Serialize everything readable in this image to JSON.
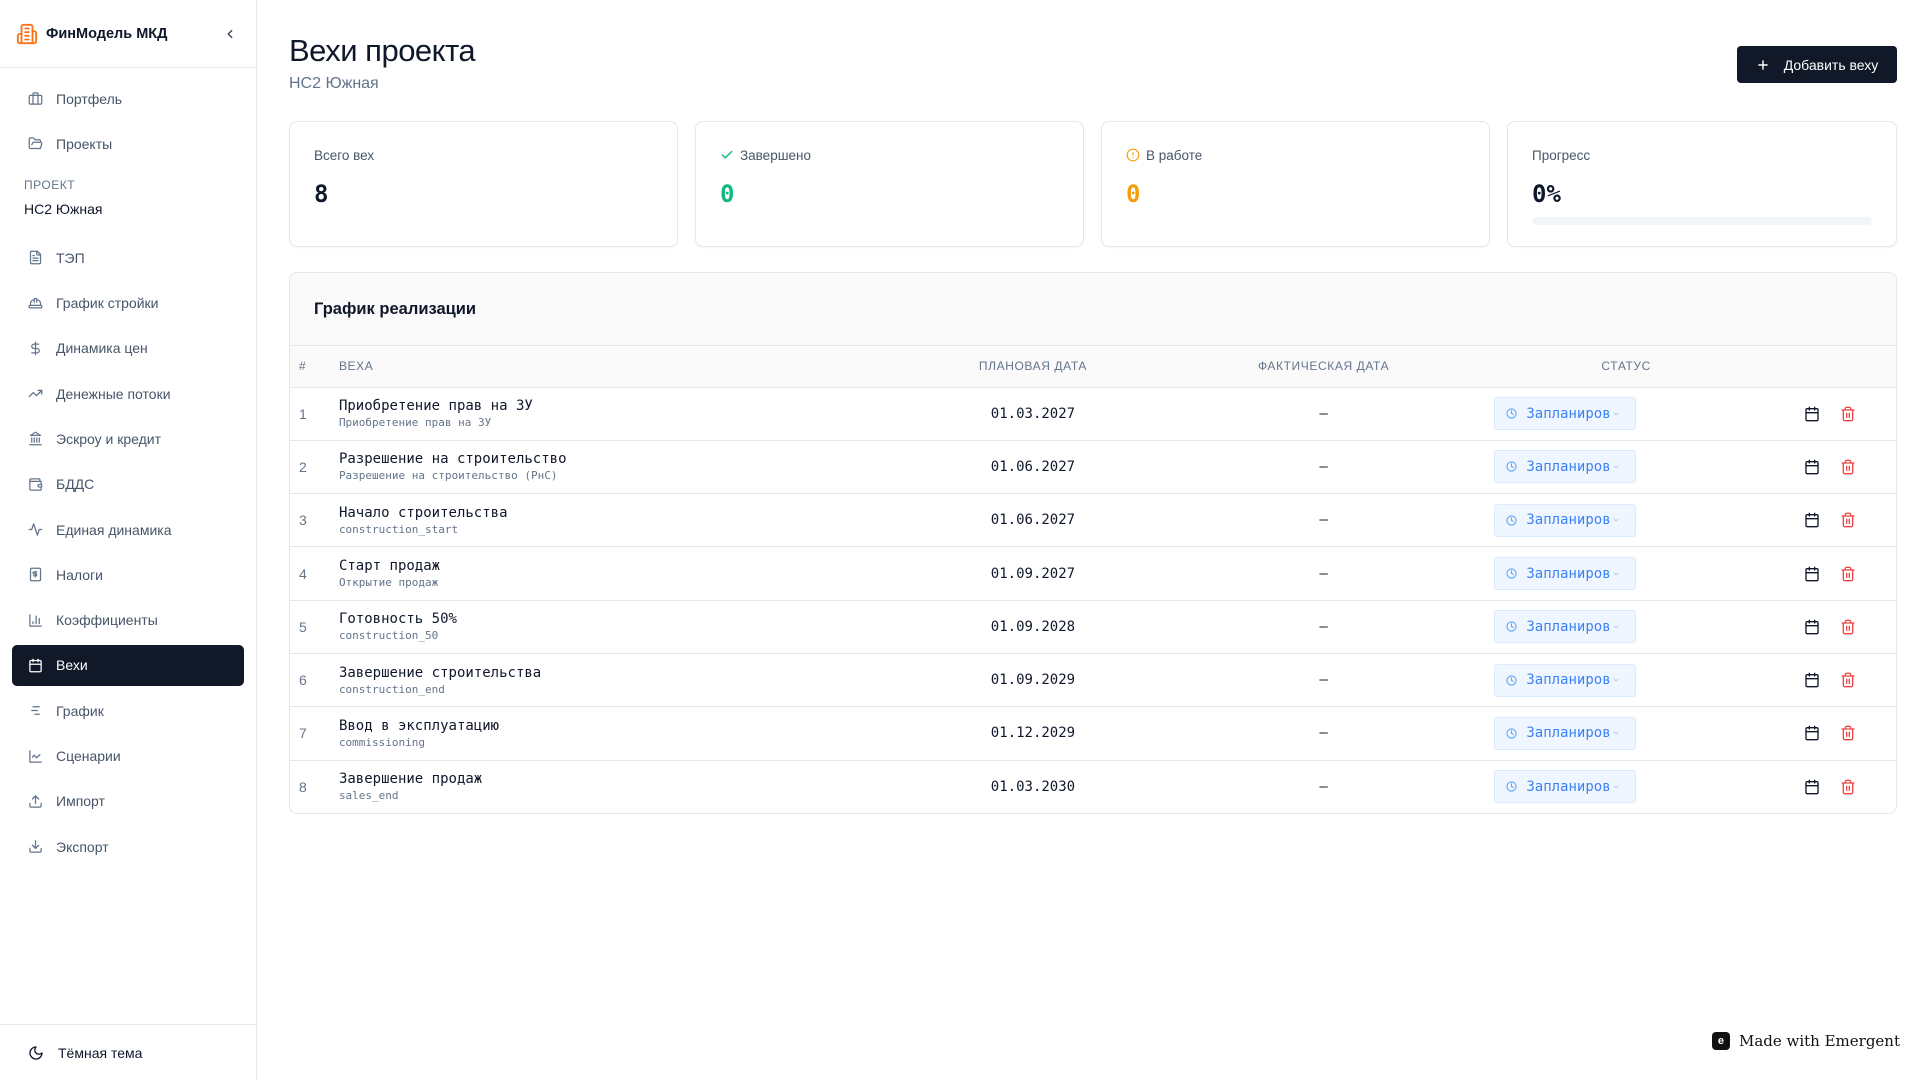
{
  "app": {
    "name": "ФинМодель МКД",
    "accent": "#f97316"
  },
  "sidebar": {
    "top_items": [
      {
        "label": "Портфель",
        "icon": "briefcase-icon"
      },
      {
        "label": "Проекты",
        "icon": "folder-open-icon"
      }
    ],
    "section_label": "ПРОЕКТ",
    "project_name": "НС2 Южная",
    "items": [
      {
        "label": "ТЭП",
        "icon": "file-text-icon"
      },
      {
        "label": "График стройки",
        "icon": "hard-hat-icon"
      },
      {
        "label": "Динамика цен",
        "icon": "dollar-icon"
      },
      {
        "label": "Денежные потоки",
        "icon": "trending-up-icon"
      },
      {
        "label": "Эскроу и кредит",
        "icon": "bank-icon"
      },
      {
        "label": "БДДС",
        "icon": "wallet-icon"
      },
      {
        "label": "Единая динамика",
        "icon": "activity-icon"
      },
      {
        "label": "Налоги",
        "icon": "receipt-icon"
      },
      {
        "label": "Коэффициенты",
        "icon": "bar-chart-icon"
      },
      {
        "label": "Вехи",
        "icon": "calendar-icon",
        "active": true
      },
      {
        "label": "График",
        "icon": "gantt-icon"
      },
      {
        "label": "Сценарии",
        "icon": "line-chart-icon"
      },
      {
        "label": "Импорт",
        "icon": "upload-icon"
      },
      {
        "label": "Экспорт",
        "icon": "download-icon"
      }
    ],
    "footer_label": "Тёмная тема"
  },
  "header": {
    "title": "Вехи проекта",
    "subtitle": "НС2 Южная",
    "add_button": "Добавить веху"
  },
  "stats": {
    "total": {
      "label": "Всего вех",
      "value": "8"
    },
    "done": {
      "label": "Завершено",
      "value": "0",
      "color": "#10b981"
    },
    "in_progress": {
      "label": "В работе",
      "value": "0",
      "color": "#f59e0b"
    },
    "progress": {
      "label": "Прогресс",
      "value": "0%",
      "fraction": 0
    }
  },
  "table": {
    "title": "График реализации",
    "columns": {
      "num": "#",
      "name": "ВЕХА",
      "plan": "ПЛАНОВАЯ ДАТА",
      "fact": "ФАКТИЧЕСКАЯ ДАТА",
      "status": "СТАТУС"
    },
    "rows": [
      {
        "num": "1",
        "name": "Приобретение прав на ЗУ",
        "code": "Приобретение прав на ЗУ",
        "plan": "01.03.2027",
        "fact": "—",
        "status": "Запланиров"
      },
      {
        "num": "2",
        "name": "Разрешение на строительство",
        "code": "Разрешение на строительство (РнС)",
        "plan": "01.06.2027",
        "fact": "—",
        "status": "Запланиров"
      },
      {
        "num": "3",
        "name": "Начало строительства",
        "code": "construction_start",
        "plan": "01.06.2027",
        "fact": "—",
        "status": "Запланиров"
      },
      {
        "num": "4",
        "name": "Старт продаж",
        "code": "Открытие продаж",
        "plan": "01.09.2027",
        "fact": "—",
        "status": "Запланиров"
      },
      {
        "num": "5",
        "name": "Готовность 50%",
        "code": "construction_50",
        "plan": "01.09.2028",
        "fact": "—",
        "status": "Запланиров"
      },
      {
        "num": "6",
        "name": "Завершение строительства",
        "code": "construction_end",
        "plan": "01.09.2029",
        "fact": "—",
        "status": "Запланиров"
      },
      {
        "num": "7",
        "name": "Ввод в эксплуатацию",
        "code": "commissioning",
        "plan": "01.12.2029",
        "fact": "—",
        "status": "Запланиров"
      },
      {
        "num": "8",
        "name": "Завершение продаж",
        "code": "sales_end",
        "plan": "01.03.2030",
        "fact": "—",
        "status": "Запланиров"
      }
    ]
  },
  "badge": {
    "text": "Made with Emergent"
  }
}
